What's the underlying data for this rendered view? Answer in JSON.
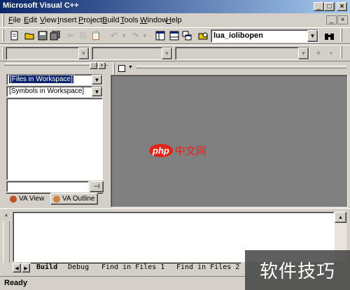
{
  "window": {
    "title": "Microsoft Visual C++",
    "minimize_glyph": "_",
    "maximize_glyph": "□",
    "close_glyph": "×"
  },
  "menu": [
    "File",
    "Edit",
    "View",
    "Insert",
    "Project",
    "Build",
    "Tools",
    "Window",
    "Help"
  ],
  "menu_underline": [
    "F",
    "E",
    "V",
    "I",
    "P",
    "B",
    "T",
    "W",
    "H"
  ],
  "find_combo": {
    "value": "lua_iolibopen"
  },
  "workspace": {
    "files_combo": "[Files in Workspace]",
    "symbols_combo": "[Symbols in Workspace]",
    "tabs": [
      "VA View",
      "VA Outline"
    ]
  },
  "output": {
    "tabs": [
      "Build",
      "Debug",
      "Find in Files 1",
      "Find in Files 2"
    ]
  },
  "watermarks": {
    "center_logo": "php",
    "center_text": "中文网",
    "corner_text": "软件技巧"
  },
  "status": {
    "text": "Ready"
  },
  "colors": {
    "title_start": "#0a246a",
    "title_end": "#a6caf0",
    "mdi_background": "#808080",
    "face": "#d4d0c8",
    "watermark_red": "#e2231a"
  }
}
